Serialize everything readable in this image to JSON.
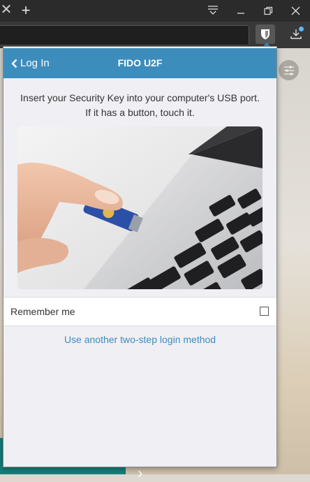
{
  "browser": {
    "tab_close_glyph": "✕",
    "new_tab_glyph": "+",
    "icons": [
      "tab-close-icon",
      "new-tab-icon",
      "tab-list-icon",
      "minimize-icon",
      "restore-icon",
      "close-icon",
      "bitwarden-shield-icon",
      "download-icon"
    ]
  },
  "background_page": {
    "banner_text": "",
    "chevron": "›",
    "settings_icon": "sliders-icon"
  },
  "popup": {
    "back_label": "Log In",
    "title": "FIDO U2F",
    "instructions": "Insert your Security Key into your computer's USB port. If it has a button, touch it.",
    "image": "security-key-photo",
    "remember_label": "Remember me",
    "remember_checked": false,
    "other_method_label": "Use another two-step login method"
  },
  "colors": {
    "header_blue": "#3c8dbc",
    "link_blue": "#3c8dbc",
    "popup_bg": "#efeff4",
    "chrome_dark": "#2b2b2b",
    "teal": "#157f7a"
  }
}
